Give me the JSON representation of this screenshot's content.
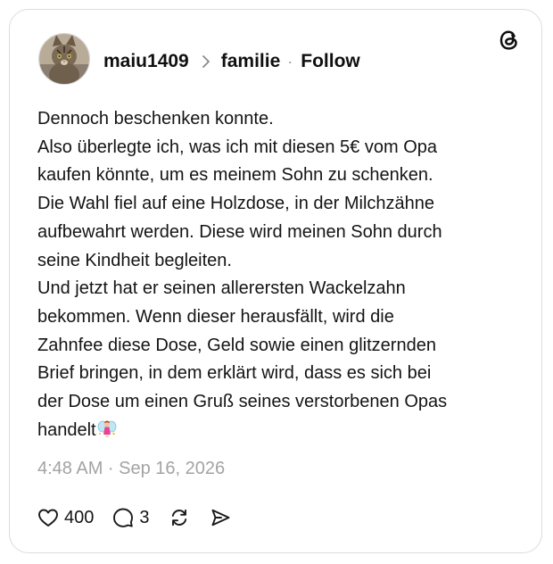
{
  "post": {
    "username": "maiu1409",
    "community": "familie",
    "follow_label": "Follow",
    "separator": "·",
    "lines": [
      "Dennoch beschenken konnte.",
      "Also überlegte ich, was ich mit diesen 5€ vom Opa",
      "kaufen könnte, um es meinem Sohn zu schenken.",
      "Die Wahl fiel auf eine Holzdose, in der Milchzähne",
      "aufbewahrt werden. Diese wird meinen Sohn durch",
      "seine Kindheit begleiten.",
      "Und jetzt hat er seinen allerersten Wackelzahn",
      "bekommen. Wenn dieser herausfällt, wird die",
      "Zahnfee diese Dose, Geld sowie einen glitzernden",
      "Brief bringen, in dem erklärt wird, dass es sich bei",
      "der Dose um einen Gruß seines verstorbenen Opas",
      "handelt"
    ],
    "timestamp": "4:48 AM · Sep 16, 2026"
  },
  "actions": {
    "likes": "400",
    "replies": "3"
  },
  "icons": {
    "avatar": "cat-avatar",
    "chevron": "chevron-right-icon",
    "logo": "threads-logo-icon",
    "emoji": "fairy-emoji-icon",
    "like": "heart-icon",
    "reply": "comment-icon",
    "repost": "repost-icon",
    "share": "share-icon"
  }
}
